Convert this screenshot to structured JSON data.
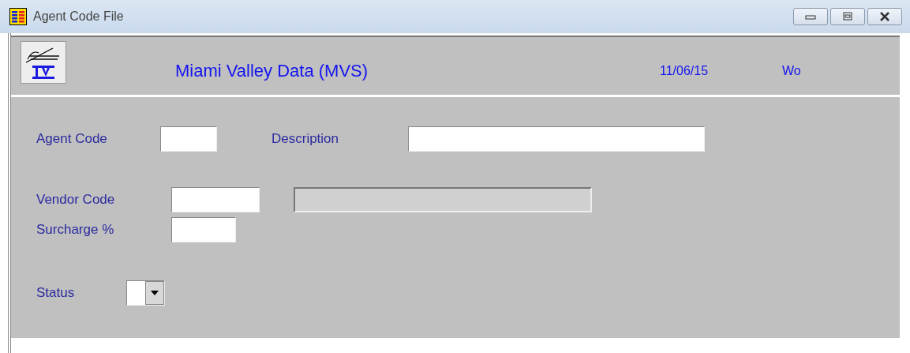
{
  "window": {
    "title": "Agent Code File"
  },
  "header": {
    "company": "Miami Valley Data (MVS)",
    "date": "11/06/15",
    "extra": "Wo"
  },
  "form": {
    "rows": [
      {
        "kind": "pair",
        "fields": [
          {
            "label": "Agent Code",
            "kind": "text"
          },
          {
            "label": "Description",
            "kind": "text"
          }
        ]
      },
      {
        "kind": "lookup",
        "fields": [
          {
            "label": "Vendor Code",
            "kind": "text"
          }
        ]
      },
      {
        "kind": "single",
        "fields": [
          {
            "label": "Surcharge %",
            "kind": "text"
          }
        ]
      },
      {
        "kind": "single",
        "fields": [
          {
            "label": "Status",
            "kind": "combo"
          }
        ]
      }
    ]
  }
}
